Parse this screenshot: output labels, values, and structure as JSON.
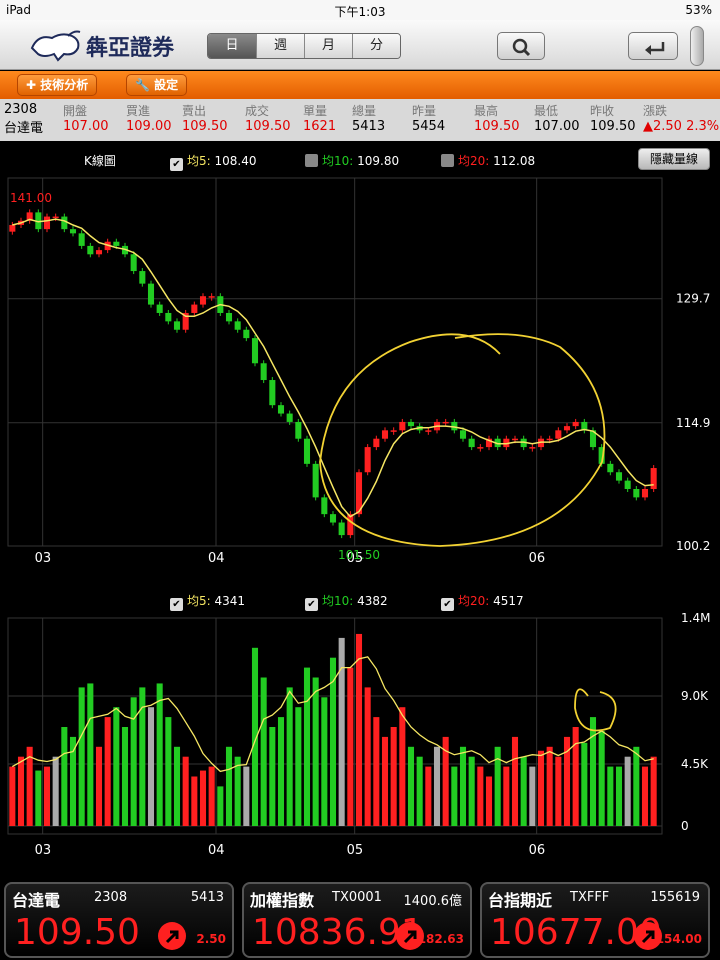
{
  "status_bar": {
    "device": "iPad",
    "time": "下午1:03",
    "battery": "53%"
  },
  "header": {
    "brand": "犇亞證券",
    "periods": [
      "日",
      "週",
      "月",
      "分"
    ],
    "active_period": "日"
  },
  "toolbar": {
    "tech_analysis_label": "技術分析",
    "settings_label": "設定"
  },
  "quote": {
    "code": "2308",
    "name": "台達電",
    "headers": [
      "開盤",
      "買進",
      "賣出",
      "成交",
      "單量",
      "總量",
      "昨量",
      "最高",
      "最低",
      "昨收",
      "漲跌"
    ],
    "values": [
      "107.00",
      "109.00",
      "109.50",
      "109.50",
      "1621",
      "5413",
      "5454",
      "109.50",
      "107.00",
      "109.50",
      "▲2.50 2.3%"
    ]
  },
  "k_chart": {
    "title": "K線圖",
    "ma5_label": "均5:",
    "ma5_value": "108.40",
    "ma10_label": "均10:",
    "ma10_value": "109.80",
    "ma20_label": "均20:",
    "ma20_value": "112.08",
    "hide_volume_button": "隱藏量線",
    "high_marker": "141.00",
    "low_marker": "101.50",
    "y_ticks": [
      "129.7",
      "114.9",
      "100.2"
    ],
    "x_ticks": [
      "03",
      "04",
      "05",
      "06"
    ]
  },
  "volume_chart": {
    "ma5_label": "均5:",
    "ma5_value": "4341",
    "ma10_label": "均10:",
    "ma10_value": "4382",
    "ma20_label": "均20:",
    "ma20_value": "4517",
    "y_ticks": [
      "1.4M",
      "9.0K",
      "4.5K",
      "0"
    ],
    "x_ticks": [
      "03",
      "04",
      "05",
      "06"
    ]
  },
  "chart_data": [
    {
      "type": "candlestick",
      "title": "K線圖",
      "y_range": [
        100.2,
        141.0
      ],
      "x_labels": [
        "03",
        "04",
        "05",
        "06"
      ],
      "closes": [
        138.5,
        139,
        140,
        138,
        139.5,
        139.5,
        138,
        137.5,
        136,
        135,
        135.5,
        136.5,
        136,
        135,
        133,
        131.5,
        129,
        128,
        127,
        126,
        128,
        129,
        130,
        130,
        128,
        127,
        126,
        125,
        122,
        120,
        117,
        116,
        115,
        113,
        110,
        106,
        104,
        103,
        101.5,
        104,
        109,
        112,
        113,
        114,
        114,
        115,
        114.5,
        114,
        114,
        115,
        115,
        114,
        113,
        112,
        112,
        113,
        112,
        113,
        113,
        112,
        112,
        113,
        113,
        114,
        114.5,
        115,
        114,
        112,
        110,
        109,
        108,
        107,
        106,
        107,
        109.5
      ],
      "ma5_end": 108.4,
      "ma10_end": 109.8,
      "ma20_end": 112.08
    },
    {
      "type": "bar",
      "title": "volume",
      "ma5": 4341,
      "ma10": 4382,
      "ma20": 4517,
      "y_ticks": [
        "1.4M",
        "9.0K",
        "4.5K",
        "0"
      ]
    }
  ],
  "bottom_cards": [
    {
      "name": "台達電",
      "code": "2308",
      "volume": "5413",
      "price": "109.50",
      "change": "2.50"
    },
    {
      "name": "加權指數",
      "code": "TX0001",
      "volume": "1400.6億",
      "price": "10836.91",
      "change": "182.63"
    },
    {
      "name": "台指期近",
      "code": "TXFFF",
      "volume": "155619",
      "price": "10677.00",
      "change": "154.00"
    }
  ],
  "colors": {
    "up": "#ff2020",
    "down": "#22cc22",
    "ma5": "#f5e663",
    "ma10": "#22cc22",
    "ma20": "#ff2020",
    "orange": "#f07010"
  }
}
